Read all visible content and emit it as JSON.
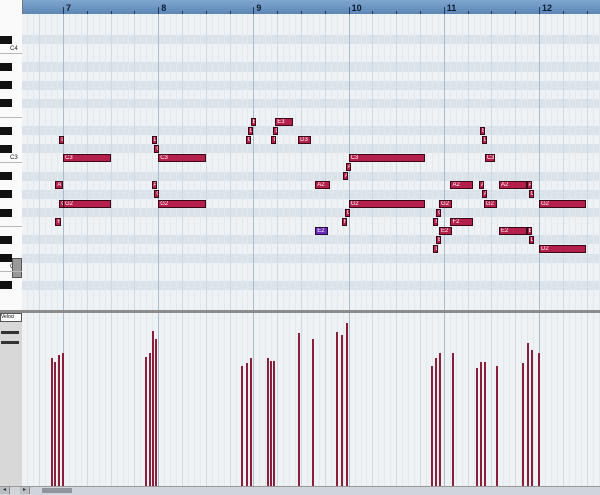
{
  "ruler": {
    "bars": [
      "7",
      "8",
      "9",
      "10",
      "11",
      "12"
    ]
  },
  "keyboard": {
    "octave_labels": [
      "C4",
      "C3",
      "C2"
    ]
  },
  "notes": [
    {
      "label": "C3",
      "pitch": "C3",
      "bar": 7.0,
      "len": 0.5
    },
    {
      "label": "D",
      "pitch": "D3",
      "bar": 6.96,
      "len": 0.05
    },
    {
      "label": "A",
      "pitch": "A2",
      "bar": 6.92,
      "len": 0.08
    },
    {
      "label": "G2",
      "pitch": "G2",
      "bar": 7.0,
      "len": 0.5
    },
    {
      "label": "G",
      "pitch": "G2",
      "bar": 6.96,
      "len": 0.05
    },
    {
      "label": "F",
      "pitch": "F2",
      "bar": 6.92,
      "len": 0.06
    },
    {
      "label": "D",
      "pitch": "D3",
      "bar": 7.93,
      "len": 0.05
    },
    {
      "label": "C",
      "pitch": "C#3",
      "bar": 7.96,
      "len": 0.05
    },
    {
      "label": "C3",
      "pitch": "C3",
      "bar": 8.0,
      "len": 0.5
    },
    {
      "label": "A",
      "pitch": "A2",
      "bar": 7.93,
      "len": 0.05
    },
    {
      "label": "G",
      "pitch": "G#2",
      "bar": 7.96,
      "len": 0.05
    },
    {
      "label": "G2",
      "pitch": "G2",
      "bar": 8.0,
      "len": 0.5
    },
    {
      "label": "E",
      "pitch": "E3",
      "bar": 8.97,
      "len": 0.06
    },
    {
      "label": "E3",
      "pitch": "E3",
      "bar": 9.23,
      "len": 0.19
    },
    {
      "label": "D",
      "pitch": "D#3",
      "bar": 8.94,
      "len": 0.05
    },
    {
      "label": "D",
      "pitch": "D#3",
      "bar": 9.21,
      "len": 0.05
    },
    {
      "label": "C",
      "pitch": "D3",
      "bar": 8.92,
      "len": 0.05
    },
    {
      "label": "C",
      "pitch": "D3",
      "bar": 9.19,
      "len": 0.05
    },
    {
      "label": "D3",
      "pitch": "D3",
      "bar": 9.47,
      "len": 0.14
    },
    {
      "label": "C3",
      "pitch": "C3",
      "bar": 10.0,
      "len": 0.8
    },
    {
      "label": "A",
      "pitch": "B2",
      "bar": 9.97,
      "len": 0.05
    },
    {
      "label": "A",
      "pitch": "A#2",
      "bar": 9.94,
      "len": 0.05
    },
    {
      "label": "A2",
      "pitch": "A2",
      "bar": 9.65,
      "len": 0.15
    },
    {
      "label": "G2",
      "pitch": "G2",
      "bar": 10.0,
      "len": 0.8
    },
    {
      "label": "G",
      "pitch": "F#2",
      "bar": 9.96,
      "len": 0.05
    },
    {
      "label": "F",
      "pitch": "F2",
      "bar": 9.93,
      "len": 0.05
    },
    {
      "label": "E2",
      "pitch": "E2",
      "bar": 9.65,
      "len": 0.13,
      "color": "purple"
    },
    {
      "label": "E",
      "pitch": "D#3",
      "bar": 11.38,
      "len": 0.05
    },
    {
      "label": "D",
      "pitch": "D3",
      "bar": 11.4,
      "len": 0.05
    },
    {
      "label": "C3",
      "pitch": "C3",
      "bar": 11.43,
      "len": 0.11
    },
    {
      "label": "A2",
      "pitch": "A2",
      "bar": 11.07,
      "len": 0.24
    },
    {
      "label": "A",
      "pitch": "A2",
      "bar": 11.37,
      "len": 0.05
    },
    {
      "label": "A2",
      "pitch": "A2",
      "bar": 11.58,
      "len": 0.29
    },
    {
      "label": "A",
      "pitch": "A2",
      "bar": 11.87,
      "len": 0.05
    },
    {
      "label": "G2",
      "pitch": "G2",
      "bar": 10.95,
      "len": 0.14
    },
    {
      "label": "A",
      "pitch": "G#2",
      "bar": 11.4,
      "len": 0.05
    },
    {
      "label": "G2",
      "pitch": "G2",
      "bar": 11.42,
      "len": 0.14
    },
    {
      "label": "G",
      "pitch": "G#2",
      "bar": 11.89,
      "len": 0.05
    },
    {
      "label": "G2",
      "pitch": "G2",
      "bar": 12.0,
      "len": 0.49
    },
    {
      "label": "G",
      "pitch": "F#2",
      "bar": 10.92,
      "len": 0.05
    },
    {
      "label": "F",
      "pitch": "F2",
      "bar": 10.89,
      "len": 0.05
    },
    {
      "label": "F2",
      "pitch": "F2",
      "bar": 11.07,
      "len": 0.24
    },
    {
      "label": "E2",
      "pitch": "E2",
      "bar": 10.95,
      "len": 0.14
    },
    {
      "label": "E",
      "pitch": "D#2",
      "bar": 10.92,
      "len": 0.05
    },
    {
      "label": "E2",
      "pitch": "E2",
      "bar": 11.58,
      "len": 0.29
    },
    {
      "label": "E",
      "pitch": "E2",
      "bar": 11.87,
      "len": 0.05
    },
    {
      "label": "D",
      "pitch": "D#2",
      "bar": 11.89,
      "len": 0.05
    },
    {
      "label": "D2",
      "pitch": "D2",
      "bar": 12.0,
      "len": 0.49
    },
    {
      "label": "D",
      "pitch": "D2",
      "bar": 10.89,
      "len": 0.05
    }
  ],
  "velocity": {
    "selector_label": "Veloci",
    "events": [
      {
        "bar": 6.88,
        "value": 94
      },
      {
        "bar": 6.92,
        "value": 91
      },
      {
        "bar": 6.96,
        "value": 96
      },
      {
        "bar": 7.0,
        "value": 98
      },
      {
        "bar": 7.87,
        "value": 95
      },
      {
        "bar": 7.91,
        "value": 98
      },
      {
        "bar": 7.95,
        "value": 114
      },
      {
        "bar": 7.98,
        "value": 108
      },
      {
        "bar": 8.88,
        "value": 88
      },
      {
        "bar": 8.93,
        "value": 90
      },
      {
        "bar": 8.97,
        "value": 94
      },
      {
        "bar": 9.15,
        "value": 94
      },
      {
        "bar": 9.19,
        "value": 92
      },
      {
        "bar": 9.22,
        "value": 92
      },
      {
        "bar": 9.48,
        "value": 112
      },
      {
        "bar": 9.63,
        "value": 108
      },
      {
        "bar": 9.88,
        "value": 113
      },
      {
        "bar": 9.93,
        "value": 111
      },
      {
        "bar": 9.98,
        "value": 120
      },
      {
        "bar": 10.88,
        "value": 88
      },
      {
        "bar": 10.92,
        "value": 94
      },
      {
        "bar": 10.96,
        "value": 98
      },
      {
        "bar": 11.1,
        "value": 98
      },
      {
        "bar": 11.35,
        "value": 87
      },
      {
        "bar": 11.39,
        "value": 91
      },
      {
        "bar": 11.43,
        "value": 91
      },
      {
        "bar": 11.56,
        "value": 88
      },
      {
        "bar": 11.83,
        "value": 90
      },
      {
        "bar": 11.88,
        "value": 105
      },
      {
        "bar": 11.93,
        "value": 100
      },
      {
        "bar": 12.0,
        "value": 98
      }
    ]
  },
  "scrollbar": {
    "left_arrow": "◂",
    "right_arrow": "▸"
  }
}
